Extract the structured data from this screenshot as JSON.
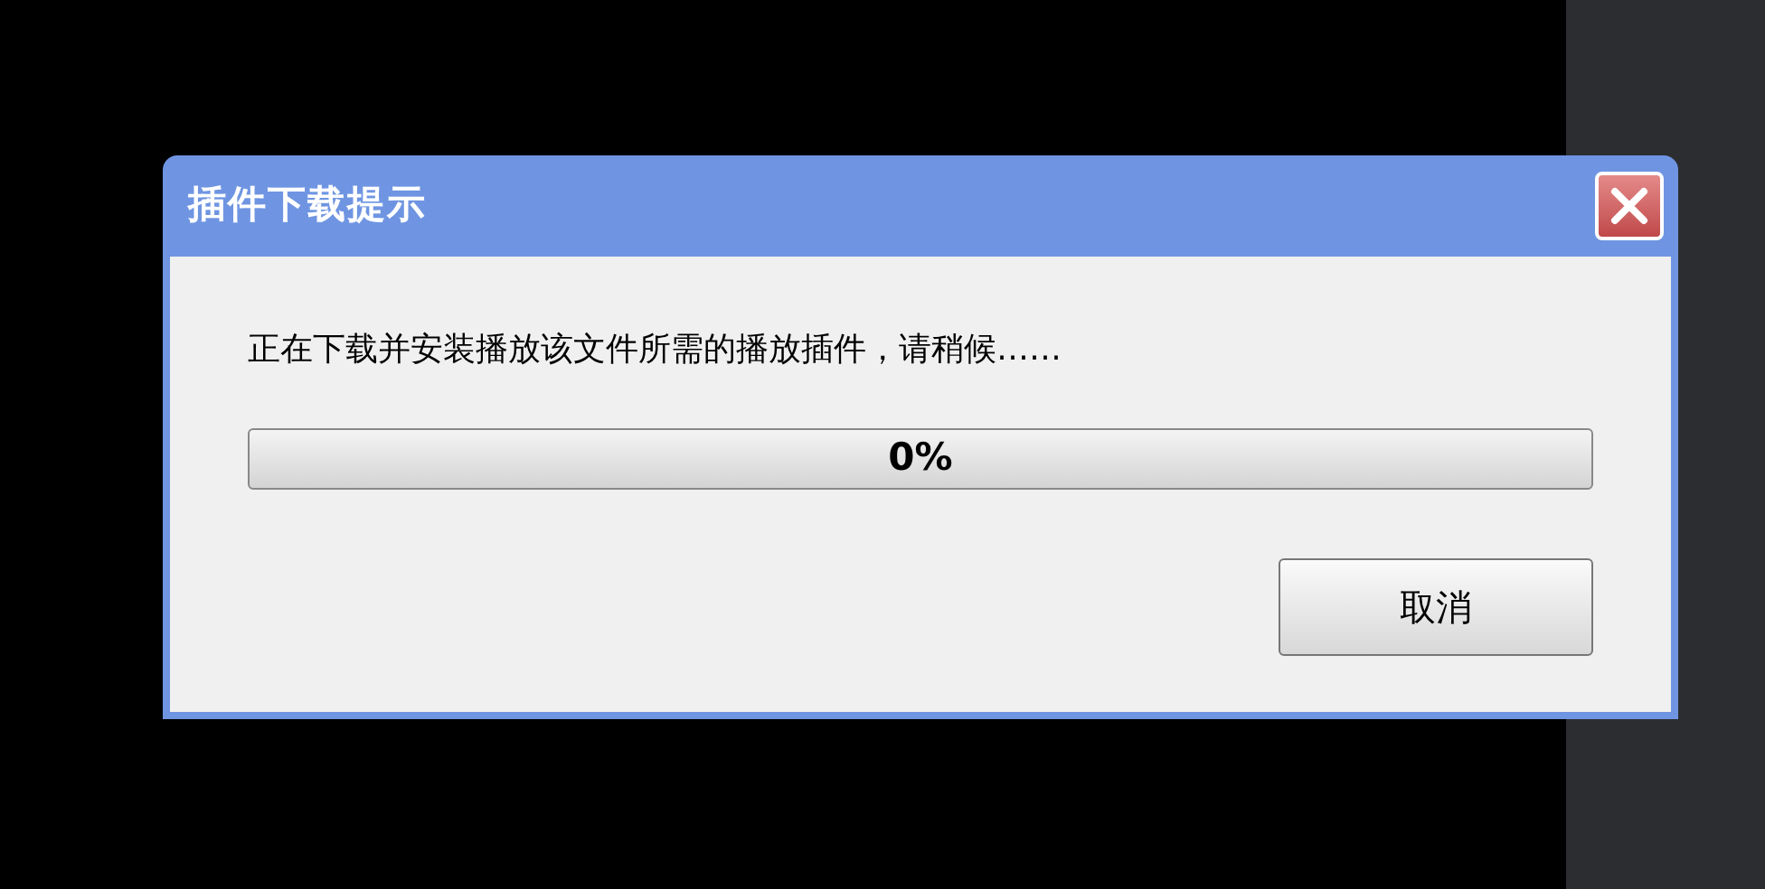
{
  "window": {
    "title": "插件下载提示"
  },
  "message": "正在下载并安装播放该文件所需的播放插件，请稍候……",
  "progress": {
    "level": 0,
    "reading": "0%"
  },
  "buttons": [
    "取消"
  ]
}
